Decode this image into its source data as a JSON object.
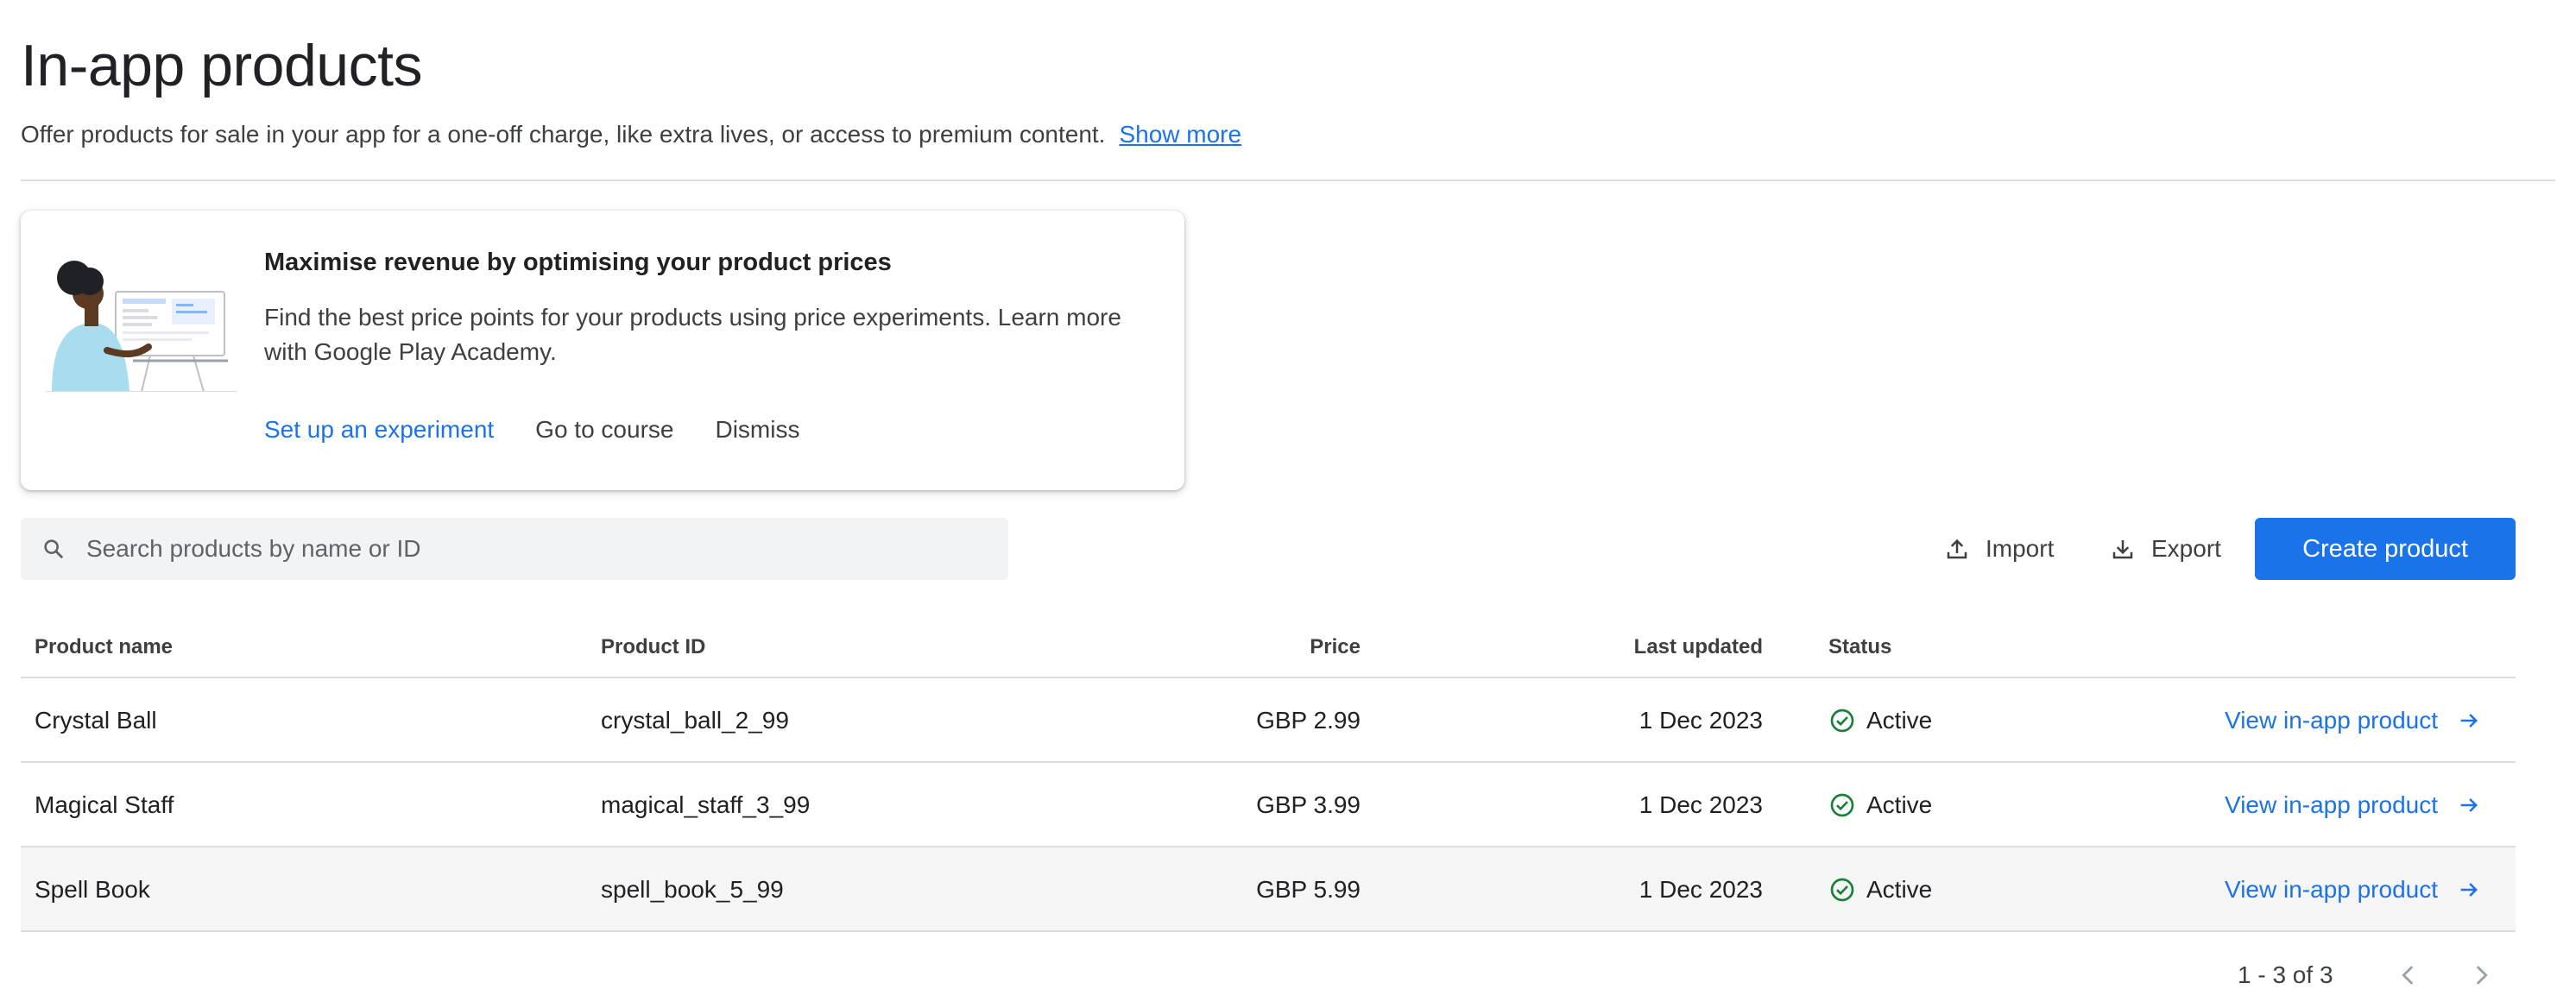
{
  "header": {
    "title": "In-app products",
    "description": "Offer products for sale in your app for a one-off charge, like extra lives, or access to premium content.",
    "show_more": "Show more"
  },
  "promo": {
    "title": "Maximise revenue by optimising your product prices",
    "body": "Find the best price points for your products using price experiments. Learn more with Google Play Academy.",
    "actions": {
      "setup": "Set up an experiment",
      "course": "Go to course",
      "dismiss": "Dismiss"
    }
  },
  "toolbar": {
    "search_placeholder": "Search products by name or ID",
    "import_label": "Import",
    "export_label": "Export",
    "create_label": "Create product"
  },
  "table": {
    "columns": {
      "name": "Product name",
      "id": "Product ID",
      "price": "Price",
      "updated": "Last updated",
      "status": "Status"
    },
    "rows": [
      {
        "name": "Crystal Ball",
        "id": "crystal_ball_2_99",
        "price": "GBP 2.99",
        "updated": "1 Dec 2023",
        "status": "Active",
        "link": "View in-app product"
      },
      {
        "name": "Magical Staff",
        "id": "magical_staff_3_99",
        "price": "GBP 3.99",
        "updated": "1 Dec 2023",
        "status": "Active",
        "link": "View in-app product"
      },
      {
        "name": "Spell Book",
        "id": "spell_book_5_99",
        "price": "GBP 5.99",
        "updated": "1 Dec 2023",
        "status": "Active",
        "link": "View in-app product"
      }
    ]
  },
  "pagination": {
    "label": "1 - 3 of 3"
  },
  "colors": {
    "accent": "#1a73e8",
    "status_active": "#188038",
    "text_primary": "#202124",
    "text_secondary": "#3c4043",
    "divider": "#dadce0"
  },
  "icons": {
    "search": "search-icon",
    "import": "upload-icon",
    "export": "download-icon",
    "status": "check-circle-icon",
    "row_link": "arrow-right-icon",
    "prev": "chevron-left-icon",
    "next": "chevron-right-icon"
  }
}
